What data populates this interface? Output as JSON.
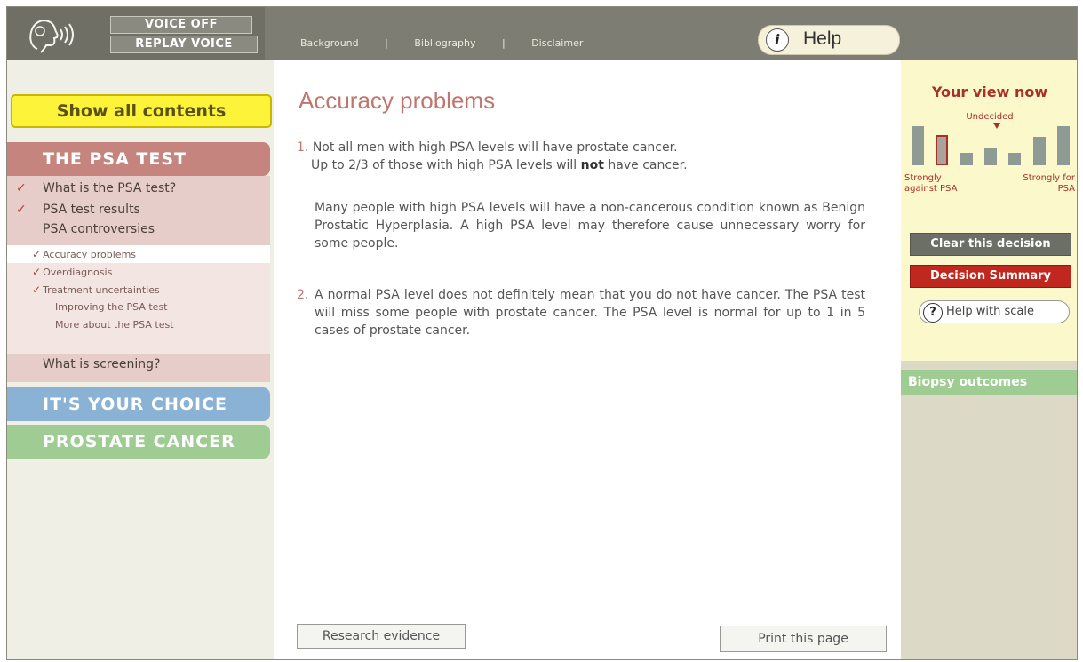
{
  "topbar": {
    "voice_off": "VOICE OFF",
    "replay_voice": "REPLAY VOICE",
    "links": [
      "Background",
      "|",
      "Bibliography",
      "|",
      "Disclaimer"
    ],
    "help": "Help",
    "help_icon": "i"
  },
  "sidebar": {
    "show_all": "Show all contents",
    "psa_test": "THE PSA TEST",
    "items": [
      {
        "label": "What is the PSA test?",
        "checked": true
      },
      {
        "label": "PSA test results",
        "checked": true
      },
      {
        "label": "PSA controversies",
        "checked": false
      }
    ],
    "sub_items": [
      {
        "label": "Accuracy problems",
        "checked": true,
        "selected": true
      },
      {
        "label": "Overdiagnosis",
        "checked": true
      },
      {
        "label": "Treatment uncertainties",
        "checked": true
      },
      {
        "label": "Improving the PSA test",
        "checked": false
      },
      {
        "label": "More about the PSA test",
        "checked": false
      }
    ],
    "screening": "What is screening?",
    "choice": "IT'S YOUR CHOICE",
    "prostate": "PROSTATE CANCER"
  },
  "main": {
    "title": "Accuracy problems",
    "p1_num": "1.",
    "p1_line1": "Not all men with high PSA levels will have prostate cancer.",
    "p1_line2_a": "Up to 2/3 of those with high PSA levels will",
    "p1_line2_bold": "not",
    "p1_line2_b": "have cancer.",
    "p1b": "Many people with high PSA levels will have a non-cancerous condition known as Benign Prostatic Hyperplasia. A high PSA level may therefore cause unnecessary worry for some people.",
    "p2_num": "2.",
    "p2": "A normal PSA level does not definitely mean that you do not have cancer. The PSA test will miss some people with prostate cancer. The PSA level is normal for up to 1 in 5 cases of prostate cancer.",
    "research": "Research evidence",
    "print": "Print this page"
  },
  "panel": {
    "title": "Your view now",
    "undecided": "Undecided",
    "against": "Strongly against PSA",
    "for": "Strongly for PSA",
    "clear": "Clear this decision",
    "summary": "Decision Summary",
    "help_scale": "Help with scale",
    "help_scale_icon": "?",
    "biopsy": "Biopsy outcomes",
    "scale_value": 2,
    "scale_steps": 7
  }
}
